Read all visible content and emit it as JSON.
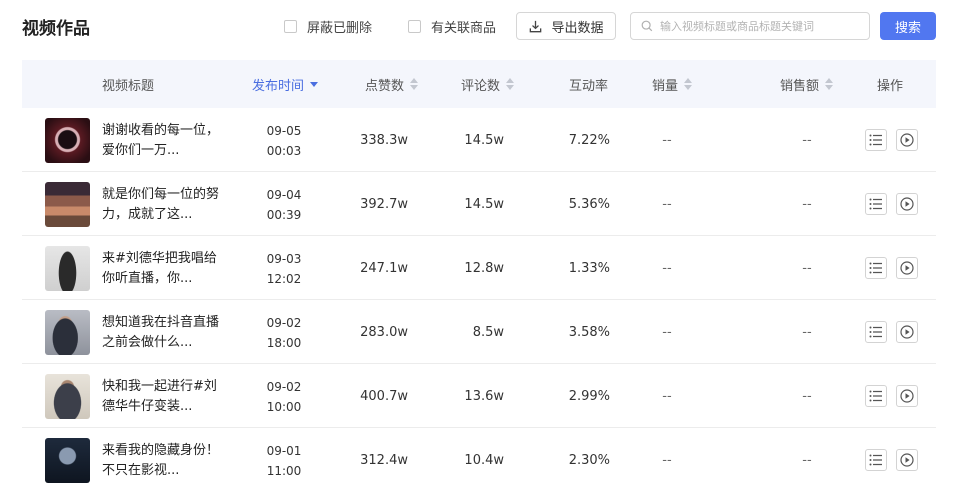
{
  "header": {
    "title": "视频作品",
    "hide_deleted_label": "屏蔽已删除",
    "linked_goods_label": "有关联商品",
    "export_label": "导出数据",
    "search_placeholder": "输入视频标题或商品标题关键词",
    "search_button": "搜索"
  },
  "table": {
    "columns": {
      "title": "视频标题",
      "publish_time": "发布时间",
      "likes": "点赞数",
      "comments": "评论数",
      "engagement": "互动率",
      "sales": "销量",
      "sales_amount": "销售额",
      "actions": "操作"
    },
    "rows": [
      {
        "title": "谢谢收看的每一位，爱你们一万...",
        "date": "09-05",
        "time": "00:03",
        "likes": "338.3w",
        "comments": "14.5w",
        "rate": "7.22%",
        "sales": "--",
        "amount": "--"
      },
      {
        "title": "就是你们每一位的努力，成就了这...",
        "date": "09-04",
        "time": "00:39",
        "likes": "392.7w",
        "comments": "14.5w",
        "rate": "5.36%",
        "sales": "--",
        "amount": "--"
      },
      {
        "title": "来#刘德华把我唱给你听直播，你...",
        "date": "09-03",
        "time": "12:02",
        "likes": "247.1w",
        "comments": "12.8w",
        "rate": "1.33%",
        "sales": "--",
        "amount": "--"
      },
      {
        "title": "想知道我在抖音直播之前会做什么...",
        "date": "09-02",
        "time": "18:00",
        "likes": "283.0w",
        "comments": "8.5w",
        "rate": "3.58%",
        "sales": "--",
        "amount": "--"
      },
      {
        "title": "快和我一起进行#刘德华牛仔变装...",
        "date": "09-02",
        "time": "10:00",
        "likes": "400.7w",
        "comments": "13.6w",
        "rate": "2.99%",
        "sales": "--",
        "amount": "--"
      },
      {
        "title": "来看我的隐藏身份！不只在影视...",
        "date": "09-01",
        "time": "11:00",
        "likes": "312.4w",
        "comments": "10.4w",
        "rate": "2.30%",
        "sales": "--",
        "amount": "--"
      }
    ]
  },
  "colors": {
    "accent": "#5177f0",
    "header_bg": "#f4f6fc",
    "sort_active": "#4a6ee0"
  },
  "icons": {
    "export": "download-icon",
    "search": "search-icon",
    "detail": "list-icon",
    "play": "play-icon"
  }
}
